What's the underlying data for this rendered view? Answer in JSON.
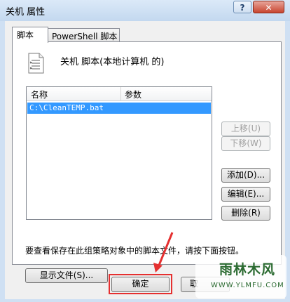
{
  "window": {
    "title": "关机 属性",
    "help_label": "?",
    "close_label": "✕"
  },
  "tabs": [
    {
      "label": "脚本"
    },
    {
      "label": "PowerShell 脚本"
    }
  ],
  "heading": "关机 脚本(本地计算机 的)",
  "list": {
    "columns": [
      "名称",
      "参数"
    ],
    "rows": [
      {
        "name": "C:\\CleanTEMP.bat",
        "params": ""
      }
    ]
  },
  "buttons": {
    "up": "上移(U)",
    "down": "下移(W)",
    "add": "添加(D)...",
    "edit": "编辑(E)...",
    "remove": "删除(R)",
    "show_files": "显示文件(S)...",
    "ok": "确定",
    "cancel": "取"
  },
  "info_text": "要查看保存在此组策略对象中的脚本文件，请按下面按钮。",
  "watermark": {
    "text": "雨林木风",
    "url": "WWW.YLMFU.COM"
  },
  "colors": {
    "selection": "#3399ff",
    "highlight_box": "#e53030"
  }
}
